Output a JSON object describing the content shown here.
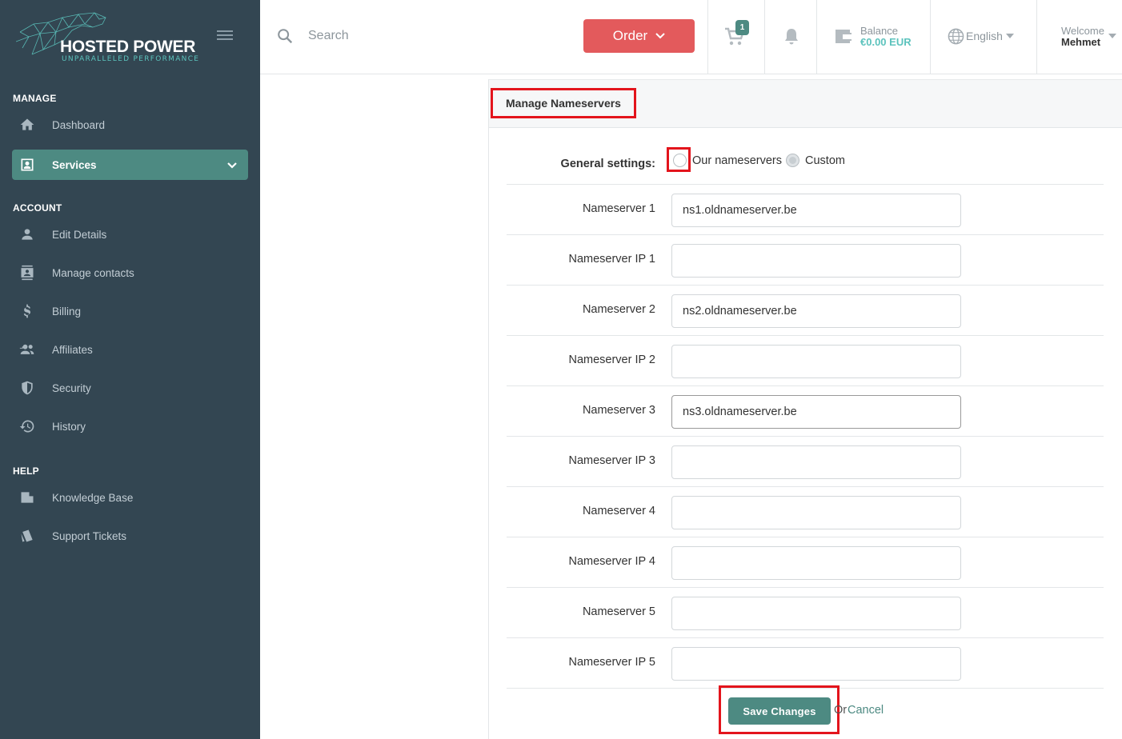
{
  "brand": {
    "name": "HOSTED POWER",
    "tagline": "UNPARALLELED PERFORMANCE"
  },
  "sidebar": {
    "sections": [
      {
        "title": "MANAGE",
        "items": [
          {
            "label": "Dashboard",
            "icon": "home-icon"
          },
          {
            "label": "Services",
            "icon": "services-icon",
            "active": true
          }
        ]
      },
      {
        "title": "ACCOUNT",
        "items": [
          {
            "label": "Edit Details",
            "icon": "user-icon"
          },
          {
            "label": "Manage contacts",
            "icon": "contacts-icon"
          },
          {
            "label": "Billing",
            "icon": "dollar-icon"
          },
          {
            "label": "Affiliates",
            "icon": "affiliates-icon"
          },
          {
            "label": "Security",
            "icon": "shield-icon"
          },
          {
            "label": "History",
            "icon": "history-icon"
          }
        ]
      },
      {
        "title": "HELP",
        "items": [
          {
            "label": "Knowledge Base",
            "icon": "folder-icon"
          },
          {
            "label": "Support Tickets",
            "icon": "tickets-icon"
          }
        ]
      }
    ]
  },
  "topbar": {
    "search_placeholder": "Search",
    "order_label": "Order",
    "cart_count": "1",
    "balance_label": "Balance",
    "balance_value": "€0.00 EUR",
    "language": "English",
    "welcome_label": "Welcome",
    "user_name": "Mehmet"
  },
  "panel": {
    "title": "Manage Nameservers",
    "general_settings_label": "General settings:",
    "radio_options": [
      {
        "label": "Our nameservers",
        "checked": false
      },
      {
        "label": "Custom",
        "checked": true
      }
    ],
    "fields": [
      {
        "label": "Nameserver 1",
        "value": "ns1.oldnameserver.be"
      },
      {
        "label": "Nameserver IP 1",
        "value": ""
      },
      {
        "label": "Nameserver 2",
        "value": "ns2.oldnameserver.be"
      },
      {
        "label": "Nameserver IP 2",
        "value": ""
      },
      {
        "label": "Nameserver 3",
        "value": "ns3.oldnameserver.be"
      },
      {
        "label": "Nameserver IP 3",
        "value": ""
      },
      {
        "label": "Nameserver 4",
        "value": ""
      },
      {
        "label": "Nameserver IP 4",
        "value": ""
      },
      {
        "label": "Nameserver 5",
        "value": ""
      },
      {
        "label": "Nameserver IP 5",
        "value": ""
      }
    ],
    "save_label": "Save Changes",
    "or_label": "Or",
    "cancel_label": "Cancel"
  },
  "colors": {
    "sidebar_bg": "#334652",
    "accent_teal": "#4d8a82",
    "order_red": "#e35a5c",
    "highlight_red": "#e3141c",
    "balance_teal": "#5cc3bd"
  }
}
